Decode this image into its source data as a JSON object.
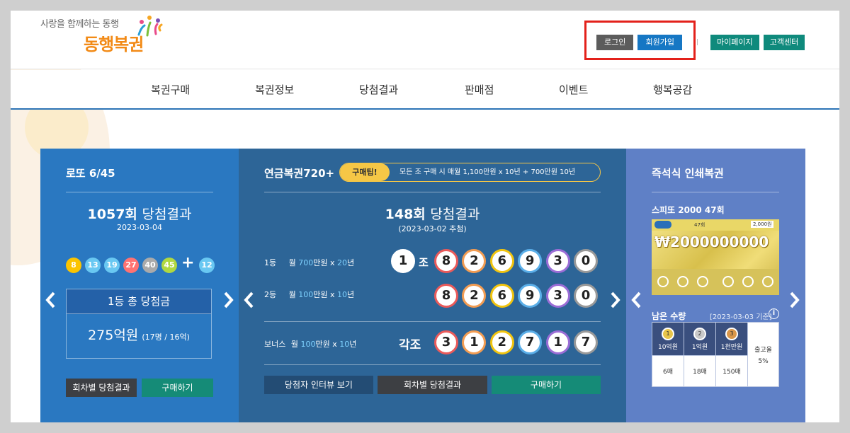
{
  "header": {
    "tagline": "사랑을 함께하는 동행",
    "logo_text": "동행복권",
    "login_label": "로그인",
    "join_label": "회원가입",
    "mypage_label": "마이페이지",
    "support_label": "고객센터"
  },
  "nav": {
    "items": [
      {
        "label": "복권구매"
      },
      {
        "label": "복권정보"
      },
      {
        "label": "당첨결과"
      },
      {
        "label": "판매점"
      },
      {
        "label": "이벤트"
      },
      {
        "label": "행복공감"
      }
    ]
  },
  "lotto": {
    "title": "로또 6/45",
    "round_num": "1057회",
    "round_suffix": "당첨결과",
    "date": "2023-03-04",
    "balls": [
      {
        "n": "8",
        "color": "#fbc400"
      },
      {
        "n": "13",
        "color": "#69c8f2"
      },
      {
        "n": "19",
        "color": "#69c8f2"
      },
      {
        "n": "27",
        "color": "#ff7272"
      },
      {
        "n": "40",
        "color": "#aaaaaa"
      },
      {
        "n": "45",
        "color": "#b0d840"
      }
    ],
    "plus": "+",
    "bonus": {
      "n": "12",
      "color": "#69c8f2"
    },
    "prize_label": "1등 총 당첨금",
    "prize_amount": "275억원",
    "prize_detail": "(17명 / 16억)",
    "btn_history": "회차별 당첨결과",
    "btn_buy": "구매하기"
  },
  "pension": {
    "title": "연금복권720+",
    "tip_label": "구매팁!",
    "tip_text": "모든 조 구매 시 매월 1,100만원 x 10년 + 700만원 10년",
    "round_num": "148회",
    "round_suffix": "당첨결과",
    "date": "(2023-03-02 추첨)",
    "rows": {
      "first": {
        "rank": "1등",
        "pre": "월",
        "amount": "700",
        "unit": "만원 x",
        "years": "20",
        "yunit": "년",
        "group": "1",
        "group_unit": "조",
        "digits": [
          "8",
          "2",
          "6",
          "9",
          "3",
          "0"
        ]
      },
      "second": {
        "rank": "2등",
        "pre": "월",
        "amount": "100",
        "unit": "만원 x",
        "years": "10",
        "yunit": "년",
        "digits": [
          "8",
          "2",
          "6",
          "9",
          "3",
          "0"
        ]
      },
      "bonus": {
        "rank": "보너스",
        "pre": "월",
        "amount": "100",
        "unit": "만원 x",
        "years": "10",
        "yunit": "년",
        "group_label": "각조",
        "digits": [
          "3",
          "1",
          "2",
          "7",
          "1",
          "7"
        ]
      }
    },
    "btn_interview": "당첨자 인터뷰 보기",
    "btn_history": "회차별 당첨결과",
    "btn_buy": "구매하기"
  },
  "instant": {
    "title": "즉석식 인쇄복권",
    "product": "스피또 2000 47회",
    "ticket_amount": "₩2000000000",
    "ticket_round": "47회",
    "ticket_price": "2,000원",
    "remaining_label": "남은 수량",
    "remaining_date": "[2023-03-03 기준]",
    "table": {
      "headers": [
        "10억원",
        "1억원",
        "1천만원"
      ],
      "counts": [
        "6매",
        "18매",
        "150매"
      ],
      "release_label": "출고율",
      "release_value": "5%"
    }
  },
  "colors": {
    "panel_lotto": "#2a78c1",
    "panel_pension": "#2d6597",
    "panel_instant": "#5f80c6",
    "highlight_box": "#e3211b"
  }
}
